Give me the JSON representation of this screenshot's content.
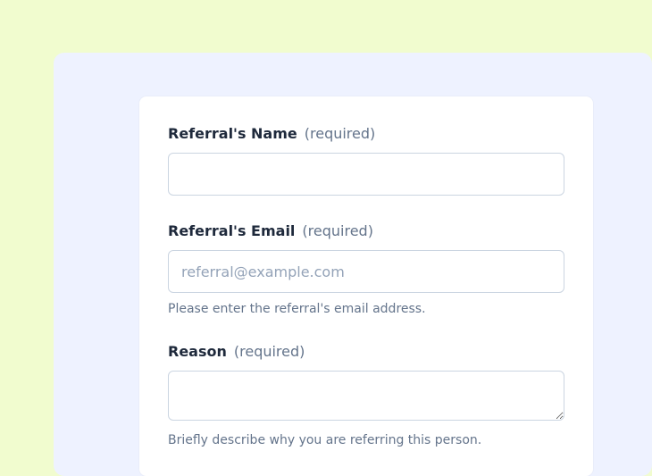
{
  "fields": {
    "name": {
      "label": "Referral's Name",
      "required_text": "(required)"
    },
    "email": {
      "label": "Referral's Email",
      "required_text": "(required)",
      "placeholder": "referral@example.com",
      "help": "Please enter the referral's email address."
    },
    "reason": {
      "label": "Reason",
      "required_text": "(required)",
      "help": "Briefly describe why you are referring this person."
    }
  }
}
